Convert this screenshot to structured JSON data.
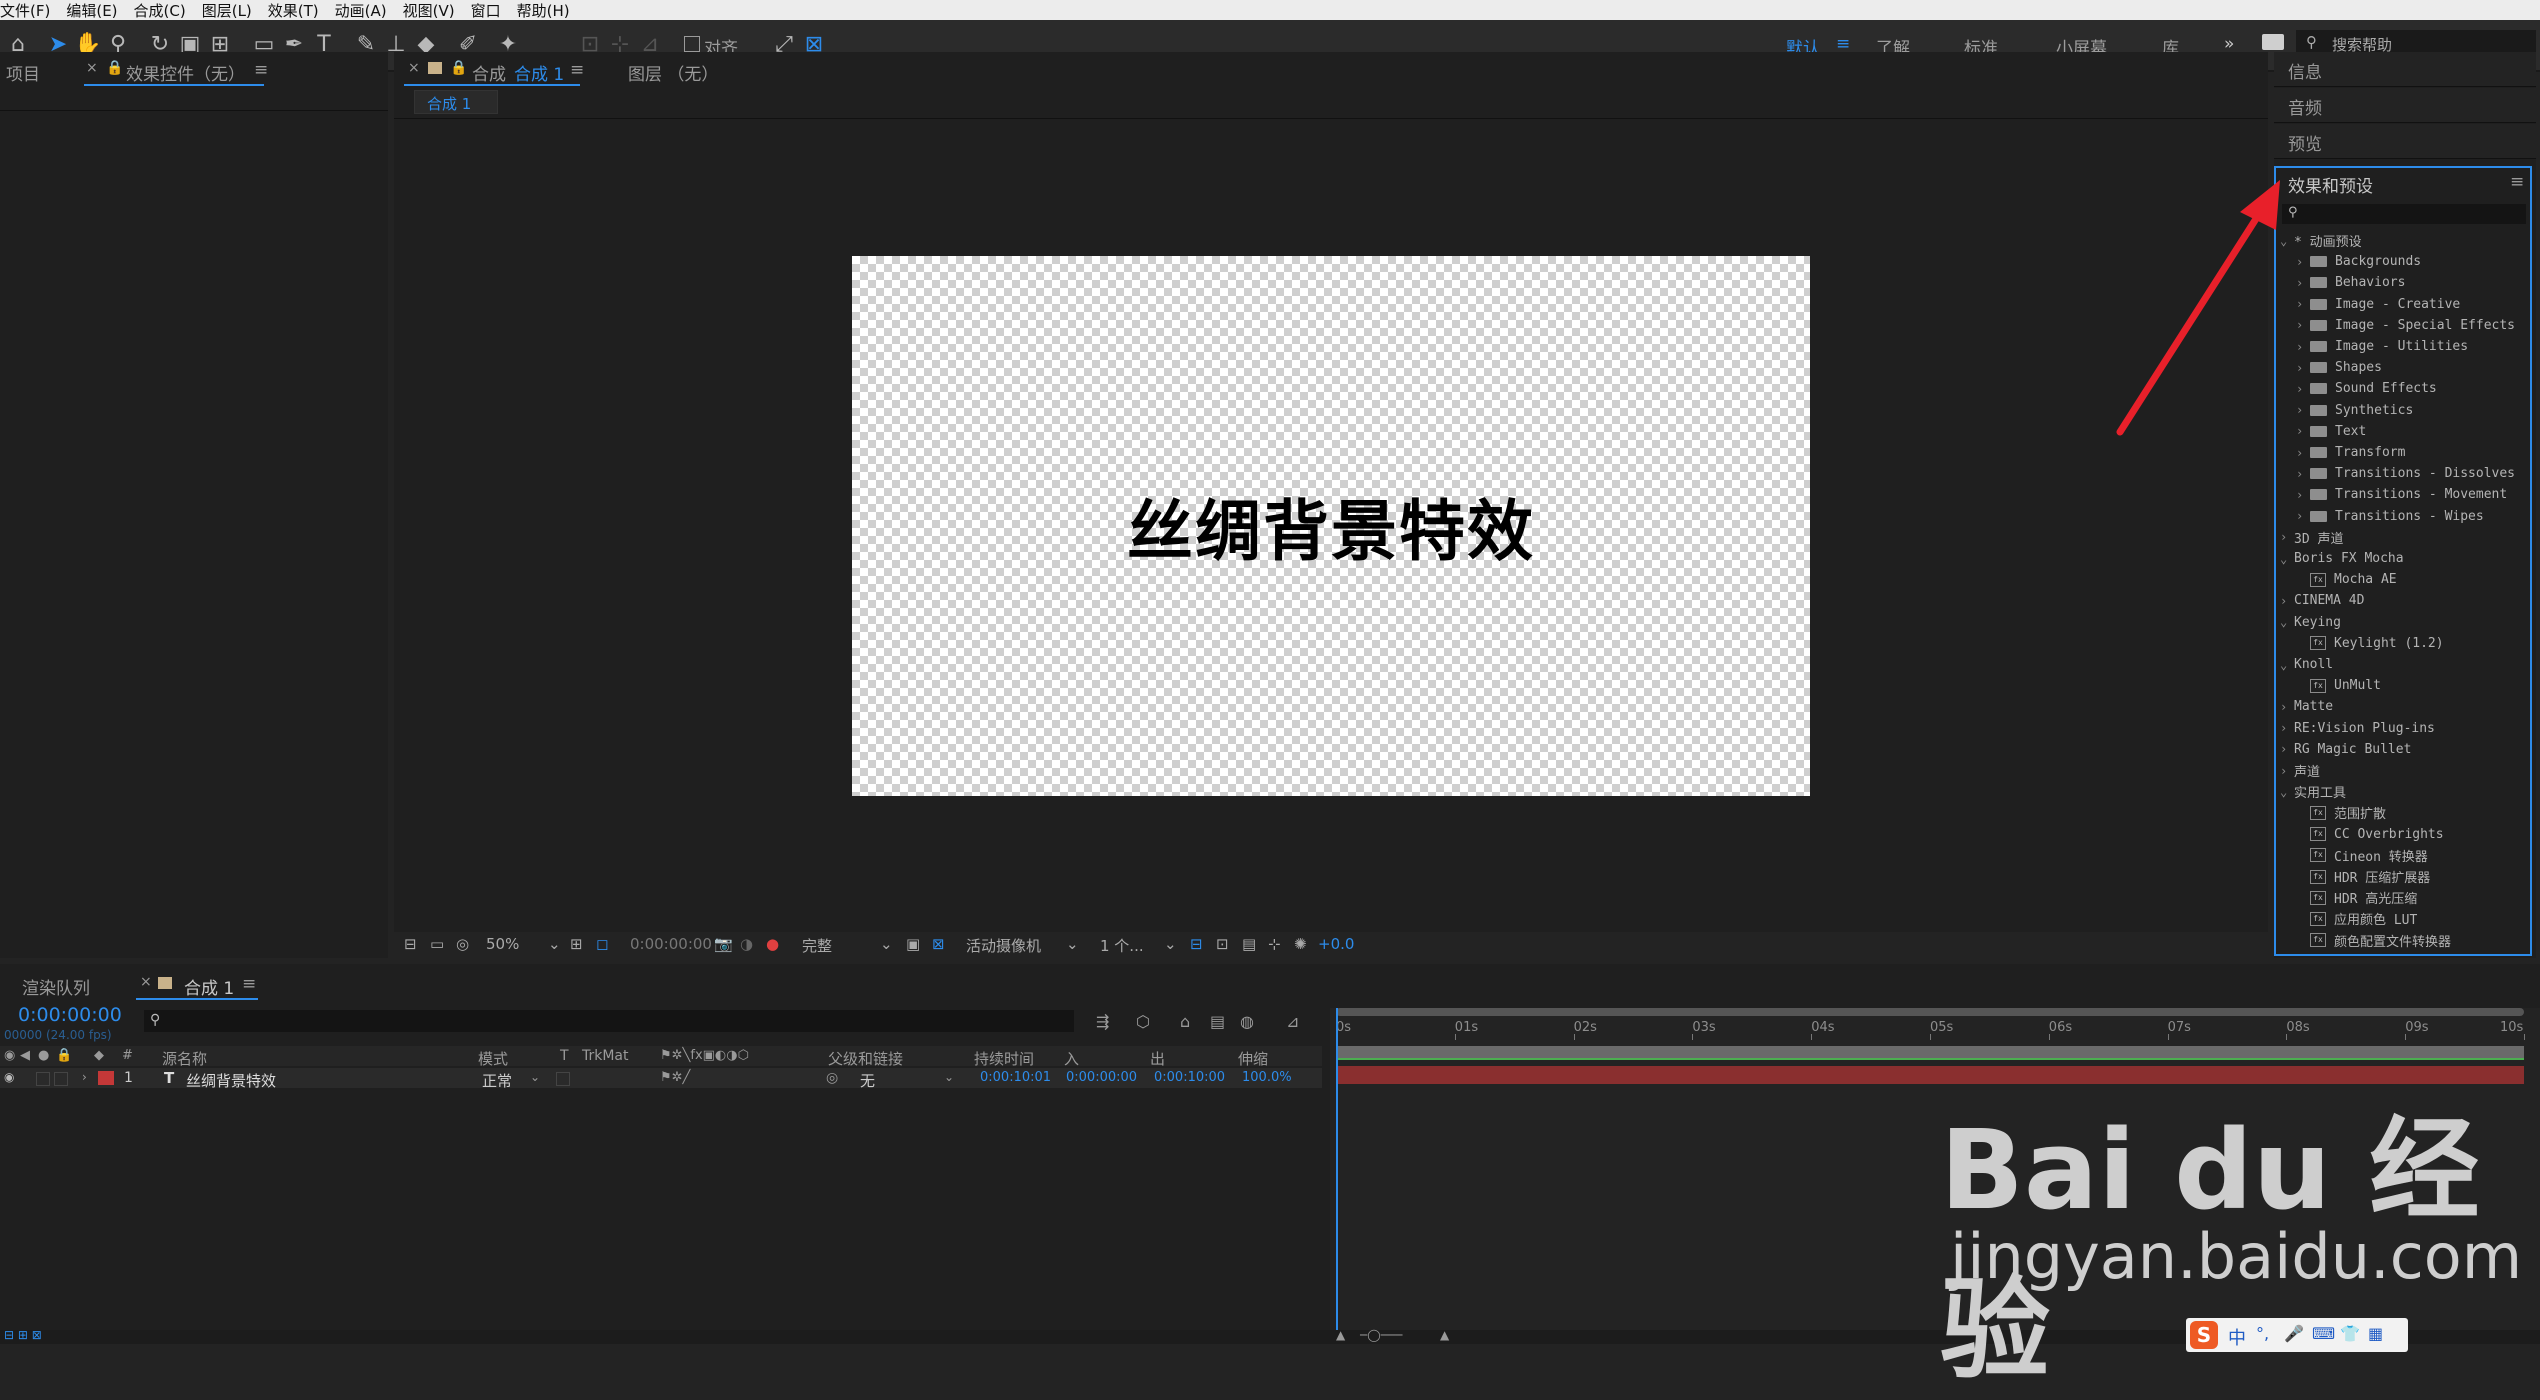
{
  "menu": [
    "文件(F)",
    "编辑(E)",
    "合成(C)",
    "图层(L)",
    "效果(T)",
    "动画(A)",
    "视图(V)",
    "窗口",
    "帮助(H)"
  ],
  "toolbar": {
    "align_label": "对齐",
    "workspaces": [
      "默认",
      "了解",
      "标准",
      "小屏幕",
      "库"
    ],
    "search_placeholder": "搜索帮助"
  },
  "left_panel": {
    "tab_project": "项目",
    "tab_effect_controls": "效果控件（无）"
  },
  "comp_panel": {
    "tab_comp": "合成",
    "tab_comp_name": "合成 1",
    "tab_layer": "图层 （无）",
    "breadcrumb": "合成 1",
    "canvas_text": "丝绸背景特效",
    "zoom": "50%",
    "timecode": "0:00:00:00",
    "resolution": "完整",
    "camera": "活动摄像机",
    "views": "1 个...",
    "exposure": "+0.0"
  },
  "right_panel": {
    "info": "信息",
    "audio": "音频",
    "preview": "预览",
    "effects_title": "效果和预设",
    "tree": [
      {
        "label": "* 动画预设",
        "level": 0,
        "kind": "open"
      },
      {
        "label": "Backgrounds",
        "level": 1,
        "kind": "folder"
      },
      {
        "label": "Behaviors",
        "level": 1,
        "kind": "folder"
      },
      {
        "label": "Image - Creative",
        "level": 1,
        "kind": "folder"
      },
      {
        "label": "Image - Special Effects",
        "level": 1,
        "kind": "folder"
      },
      {
        "label": "Image - Utilities",
        "level": 1,
        "kind": "folder"
      },
      {
        "label": "Shapes",
        "level": 1,
        "kind": "folder"
      },
      {
        "label": "Sound Effects",
        "level": 1,
        "kind": "folder"
      },
      {
        "label": "Synthetics",
        "level": 1,
        "kind": "folder"
      },
      {
        "label": "Text",
        "level": 1,
        "kind": "folder"
      },
      {
        "label": "Transform",
        "level": 1,
        "kind": "folder"
      },
      {
        "label": "Transitions - Dissolves",
        "level": 1,
        "kind": "folder"
      },
      {
        "label": "Transitions - Movement",
        "level": 1,
        "kind": "folder"
      },
      {
        "label": "Transitions - Wipes",
        "level": 1,
        "kind": "folder"
      },
      {
        "label": "3D 声道",
        "level": 0,
        "kind": "closed"
      },
      {
        "label": "Boris FX Mocha",
        "level": 0,
        "kind": "open"
      },
      {
        "label": "Mocha AE",
        "level": 1,
        "kind": "fx"
      },
      {
        "label": "CINEMA 4D",
        "level": 0,
        "kind": "closed"
      },
      {
        "label": "Keying",
        "level": 0,
        "kind": "open"
      },
      {
        "label": "Keylight (1.2)",
        "level": 1,
        "kind": "fx"
      },
      {
        "label": "Knoll",
        "level": 0,
        "kind": "open"
      },
      {
        "label": "UnMult",
        "level": 1,
        "kind": "fx"
      },
      {
        "label": "Matte",
        "level": 0,
        "kind": "closed"
      },
      {
        "label": "RE:Vision Plug-ins",
        "level": 0,
        "kind": "closed"
      },
      {
        "label": "RG Magic Bullet",
        "level": 0,
        "kind": "closed"
      },
      {
        "label": "声道",
        "level": 0,
        "kind": "closed"
      },
      {
        "label": "实用工具",
        "level": 0,
        "kind": "open"
      },
      {
        "label": "范围扩散",
        "level": 1,
        "kind": "fx"
      },
      {
        "label": "CC Overbrights",
        "level": 1,
        "kind": "fx"
      },
      {
        "label": "Cineon 转换器",
        "level": 1,
        "kind": "fx"
      },
      {
        "label": "HDR 压缩扩展器",
        "level": 1,
        "kind": "fx"
      },
      {
        "label": "HDR 高光压缩",
        "level": 1,
        "kind": "fx"
      },
      {
        "label": "应用颜色 LUT",
        "level": 1,
        "kind": "fx"
      },
      {
        "label": "颜色配置文件转换器",
        "level": 1,
        "kind": "fx"
      }
    ]
  },
  "timeline": {
    "tab_render": "渲染队列",
    "tab_comp": "合成 1",
    "timecode": "0:00:00:00",
    "fps": "00000 (24.00 fps)",
    "columns": {
      "source": "源名称",
      "mode": "模式",
      "t": "T",
      "trkmat": "TrkMat",
      "parent": "父级和链接",
      "duration": "持续时间",
      "in": "入",
      "out": "出",
      "stretch": "伸缩"
    },
    "layer": {
      "num": "1",
      "name": "丝绸背景特效",
      "mode": "正常",
      "parent": "无",
      "duration": "0:00:10:01",
      "in": "0:00:00:00",
      "out": "0:00:10:00",
      "stretch": "100.0%"
    },
    "ruler": [
      "0s",
      "01s",
      "02s",
      "03s",
      "04s",
      "05s",
      "06s",
      "07s",
      "08s",
      "09s",
      "10s"
    ]
  },
  "watermark": {
    "brand": "Bai du 经验",
    "url": "jingyan.baidu.com"
  },
  "ime": {
    "label": "中"
  },
  "colors": {
    "accent": "#2d8ceb",
    "layer_bar": "#8a2f2f",
    "arrow": "#e8202a"
  }
}
